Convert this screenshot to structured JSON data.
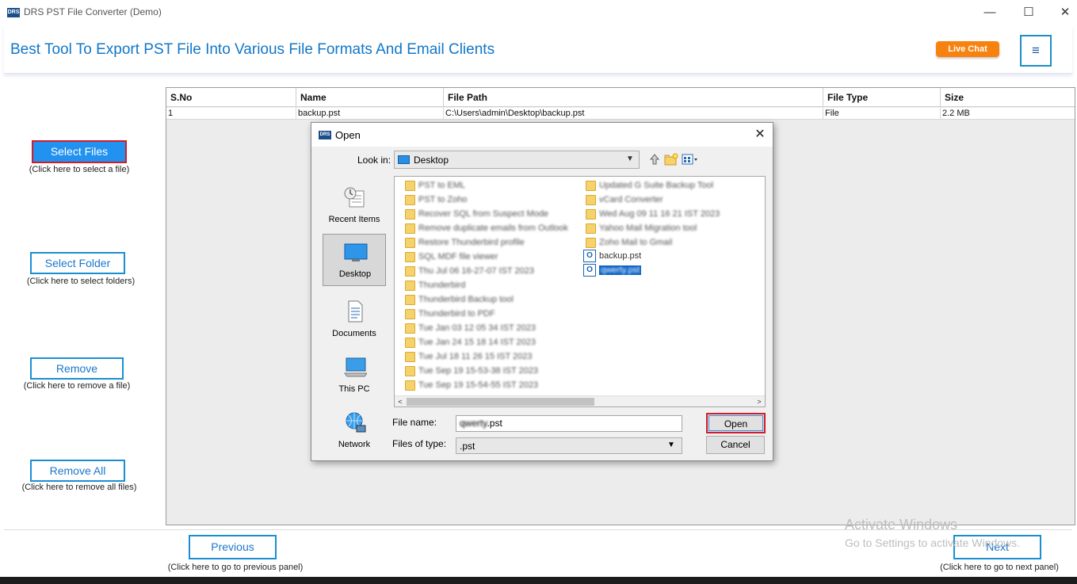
{
  "window": {
    "logo": "DRS",
    "title": "DRS PST File Converter (Demo)",
    "minimize": "—",
    "maximize": "☐",
    "close": "✕"
  },
  "header": {
    "title": "Best Tool To Export PST File Into Various File Formats And Email Clients",
    "live_chat": "Live Chat",
    "menu": "≡"
  },
  "sidebar": {
    "select_files": {
      "label": "Select Files",
      "hint": "(Click here to select a file)"
    },
    "select_folder": {
      "label": "Select Folder",
      "hint": "(Click here to select folders)"
    },
    "remove": {
      "label": "Remove",
      "hint": "(Click here to remove a file)"
    },
    "remove_all": {
      "label": "Remove All",
      "hint": "(Click here to remove all files)"
    }
  },
  "table": {
    "columns": [
      "S.No",
      "Name",
      "File Path",
      "File Type",
      "Size"
    ],
    "rows": [
      [
        "1",
        "backup.pst",
        "C:\\Users\\admin\\Desktop\\backup.pst",
        "File",
        "2.2 MB"
      ]
    ]
  },
  "footer": {
    "previous": {
      "label": "Previous",
      "hint": "(Click here to go to previous panel)"
    },
    "next": {
      "label": "Next",
      "hint": "(Click here to go to next panel)"
    },
    "watermark_line1": "Activate Windows",
    "watermark_line2": "Go to Settings to activate Windows."
  },
  "dialog": {
    "icon": "DRS",
    "title": "Open",
    "close": "✕",
    "look_in_label": "Look in:",
    "look_in_value": "Desktop",
    "places": [
      "Recent Items",
      "Desktop",
      "Documents",
      "This PC",
      "Network"
    ],
    "files_col1": [
      "PST to EML",
      "PST to Zoho",
      "Recover SQL from Suspect Mode",
      "Remove duplicate emails from Outlook",
      "Restore Thunderbird profile",
      "SQL MDF file viewer",
      "Thu Jul 06 16-27-07 IST 2023",
      "Thunderbird",
      "Thunderbird Backup tool",
      "Thunderbird to PDF",
      "Tue Jan 03 12 05 34 IST 2023",
      "Tue Jan 24 15 18 14 IST 2023",
      "Tue Jul 18 11 26 15 IST 2023",
      "Tue Sep 19 15-53-38 IST 2023",
      "Tue Sep 19 15-54-55 IST 2023"
    ],
    "files_col2": [
      "Updated G Suite Backup Tool",
      "vCard Converter",
      "Wed Aug 09 11 16 21 IST 2023",
      "Yahoo Mail Migration tool",
      "Zoho Mail to Gmail"
    ],
    "pst_files": [
      {
        "icon": "O",
        "name": "backup.pst"
      },
      {
        "icon": "O",
        "name": "qwerty.pst"
      }
    ],
    "scroll_left": "<",
    "scroll_right": ">",
    "file_name_label": "File name:",
    "file_name_blurred": "qwerty",
    "file_name_ext": ".pst",
    "files_of_type_label": "Files of type:",
    "files_of_type_value": ".pst",
    "open": "Open",
    "cancel": "Cancel"
  }
}
